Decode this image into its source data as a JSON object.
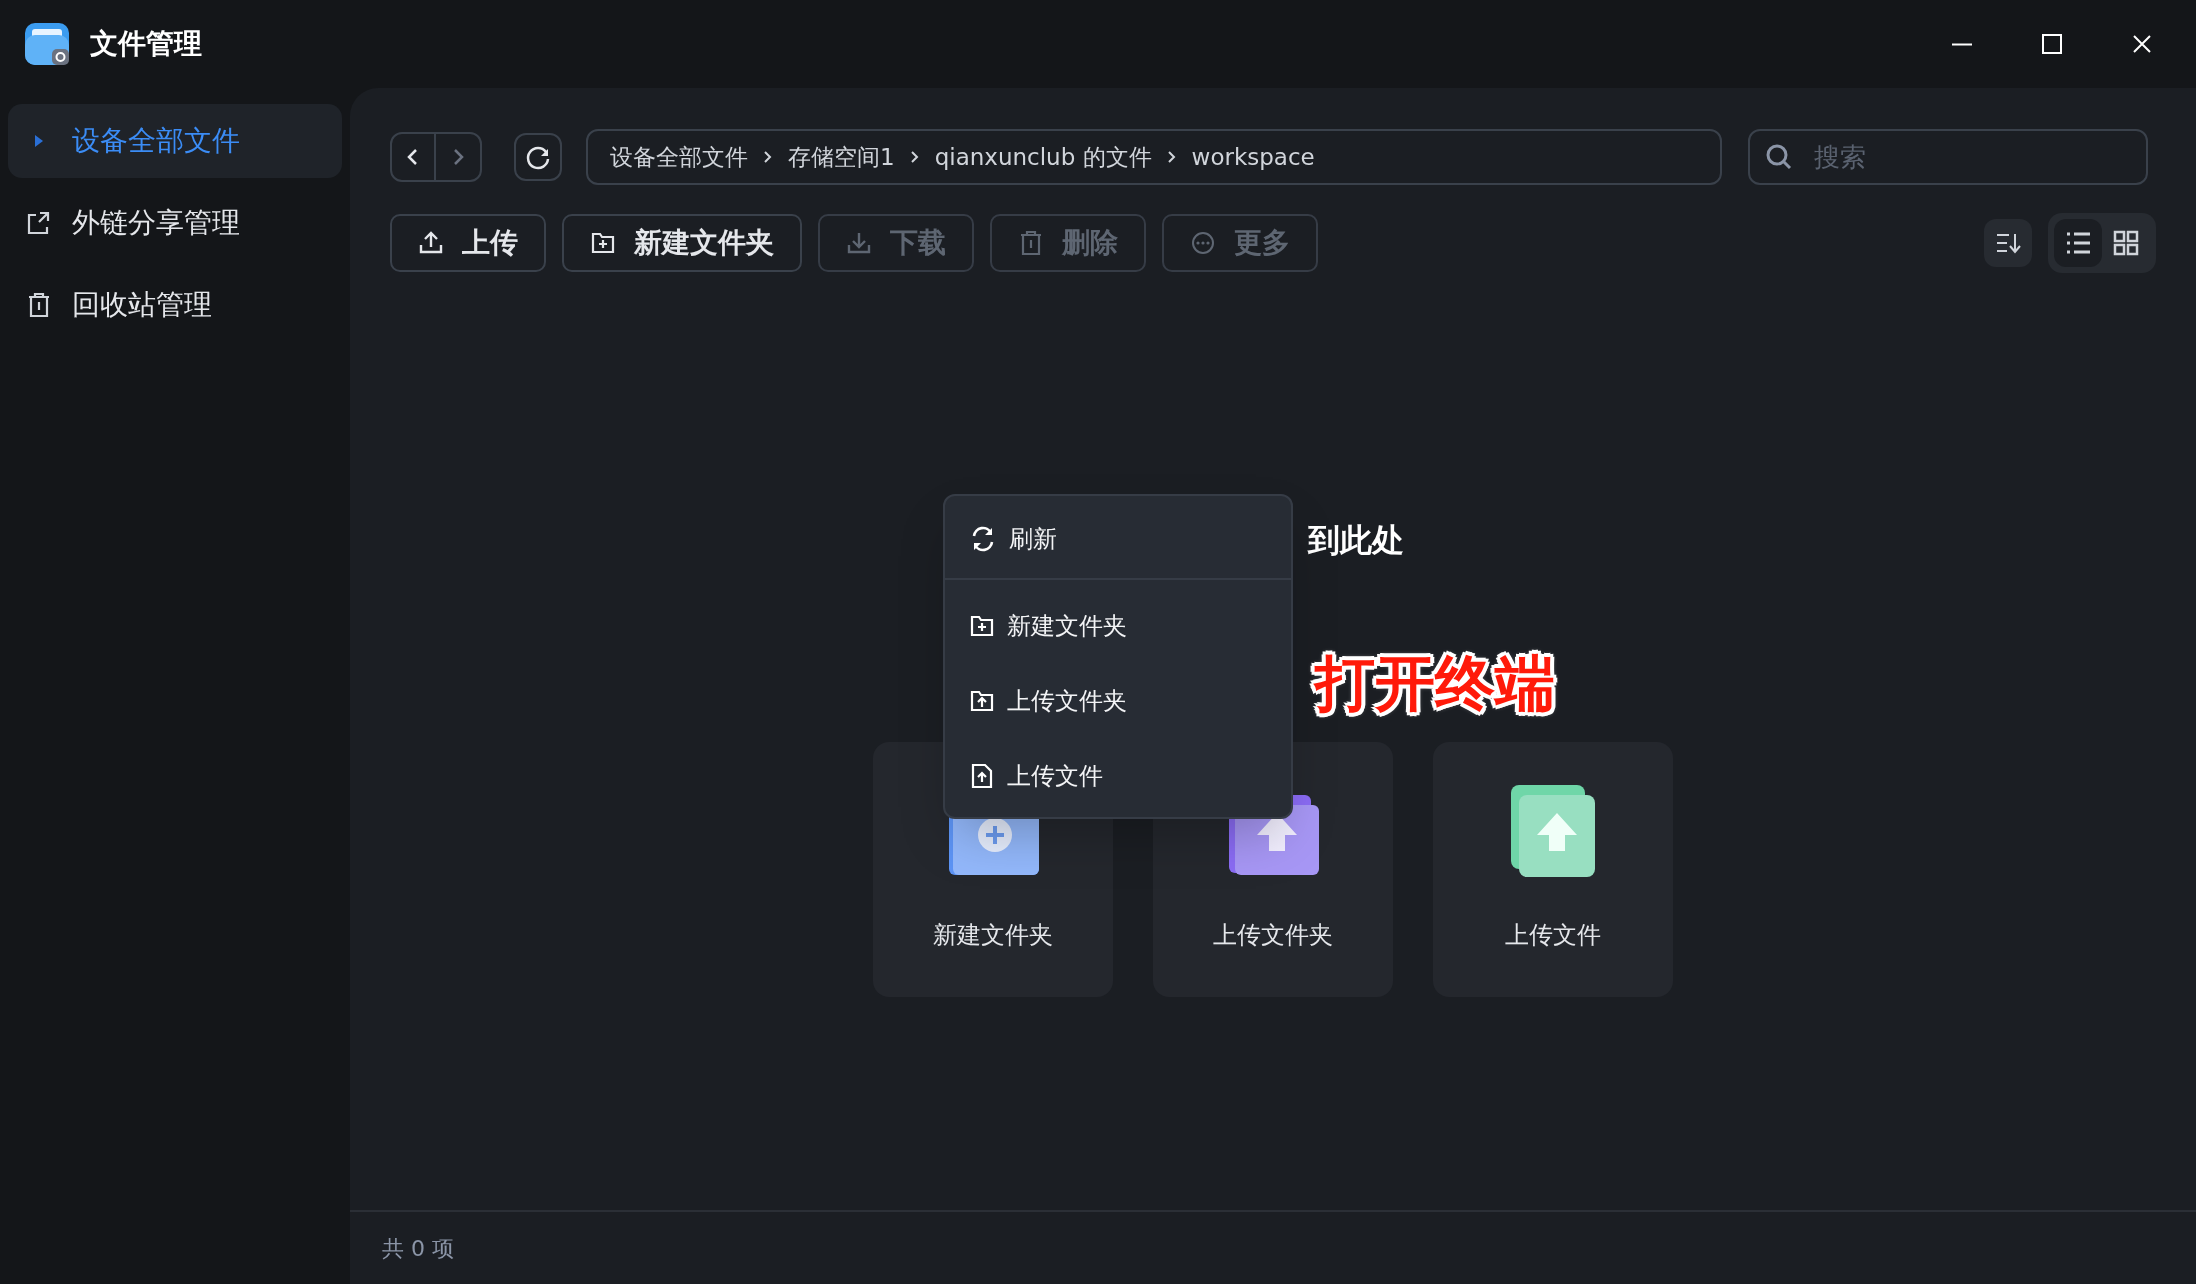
{
  "window": {
    "title": "文件管理"
  },
  "sidebar": {
    "items": [
      {
        "kind": "caret",
        "label": "设备全部文件",
        "selected": true
      },
      {
        "kind": "share",
        "label": "外链分享管理",
        "selected": false
      },
      {
        "kind": "trash",
        "label": "回收站管理",
        "selected": false
      }
    ]
  },
  "breadcrumb": [
    "设备全部文件",
    "存储空间1",
    "qianxunclub 的文件",
    "workspace"
  ],
  "search": {
    "placeholder": "搜索"
  },
  "toolbar": [
    {
      "kind": "upload",
      "label": "上传",
      "disabled": false
    },
    {
      "kind": "new-folder",
      "label": "新建文件夹",
      "disabled": false
    },
    {
      "kind": "download",
      "label": "下载",
      "disabled": true
    },
    {
      "kind": "delete",
      "label": "删除",
      "disabled": true
    },
    {
      "kind": "more",
      "label": "更多",
      "disabled": true
    }
  ],
  "view_toggle": [
    {
      "kind": "list",
      "selected": true
    },
    {
      "kind": "grid",
      "selected": false
    }
  ],
  "empty_state": {
    "heading": "到此处"
  },
  "cards": [
    {
      "kind": "new-folder",
      "label": "新建文件夹"
    },
    {
      "kind": "upload-folder",
      "label": "上传文件夹"
    },
    {
      "kind": "upload-file",
      "label": "上传文件"
    }
  ],
  "context_menu": [
    {
      "kind": "refresh",
      "label": "刷新"
    },
    {
      "kind": "new-folder",
      "label": "新建文件夹"
    },
    {
      "kind": "upload-folder",
      "label": "上传文件夹"
    },
    {
      "kind": "upload-file",
      "label": "上传文件"
    }
  ],
  "annotation": "打开终端",
  "status_bar": "共 0 项"
}
